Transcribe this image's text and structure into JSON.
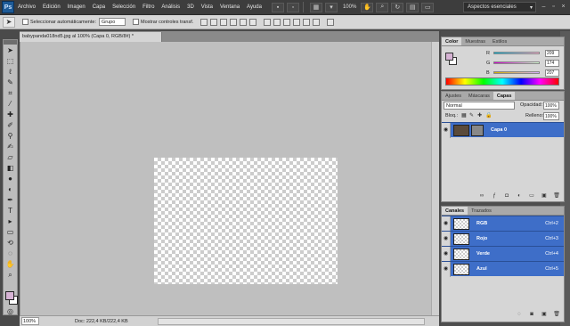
{
  "menu": {
    "logo": "Ps",
    "items": [
      "Archivo",
      "Edición",
      "Imagen",
      "Capa",
      "Selección",
      "Filtro",
      "Análisis",
      "3D",
      "Vista",
      "Ventana",
      "Ayuda"
    ],
    "zoom": "100%",
    "workspace": "Aspectos esenciales"
  },
  "options": {
    "auto_select_label": "Seleccionar automáticamente:",
    "auto_select_value": "Grupo",
    "transform_label": "Mostrar controles transf."
  },
  "document": {
    "tab_title": "babypanda018nd5.jpg al 100% (Capa 0, RGB/8#) *",
    "zoom": "100%",
    "doc_info": "Doc: 222,4 KB/222,4 KB"
  },
  "color_panel": {
    "tabs": [
      "Color",
      "Muestras",
      "Estilos"
    ],
    "channels": [
      {
        "label": "R",
        "value": "209"
      },
      {
        "label": "G",
        "value": "174"
      },
      {
        "label": "B",
        "value": "207"
      }
    ],
    "foreground": "#d6b3d4",
    "background": "#ffffff"
  },
  "layers_panel": {
    "tabs": [
      "Ajustes",
      "Máscaras",
      "Capas"
    ],
    "blend_mode": "Normal",
    "opacity_label": "Opacidad:",
    "opacity_value": "100%",
    "lock_label": "Bloq.:",
    "fill_label": "Relleno:",
    "fill_value": "100%",
    "layer_name": "Capa 0"
  },
  "channels_panel": {
    "tabs": [
      "Canales",
      "Trazados"
    ],
    "rows": [
      {
        "name": "RGB",
        "shortcut": "Ctrl+2"
      },
      {
        "name": "Rojo",
        "shortcut": "Ctrl+3"
      },
      {
        "name": "Verde",
        "shortcut": "Ctrl+4"
      },
      {
        "name": "Azul",
        "shortcut": "Ctrl+5"
      }
    ]
  },
  "colors": {
    "selection": "#3e6ec8",
    "canvas_bg": "#bfbfbf"
  }
}
